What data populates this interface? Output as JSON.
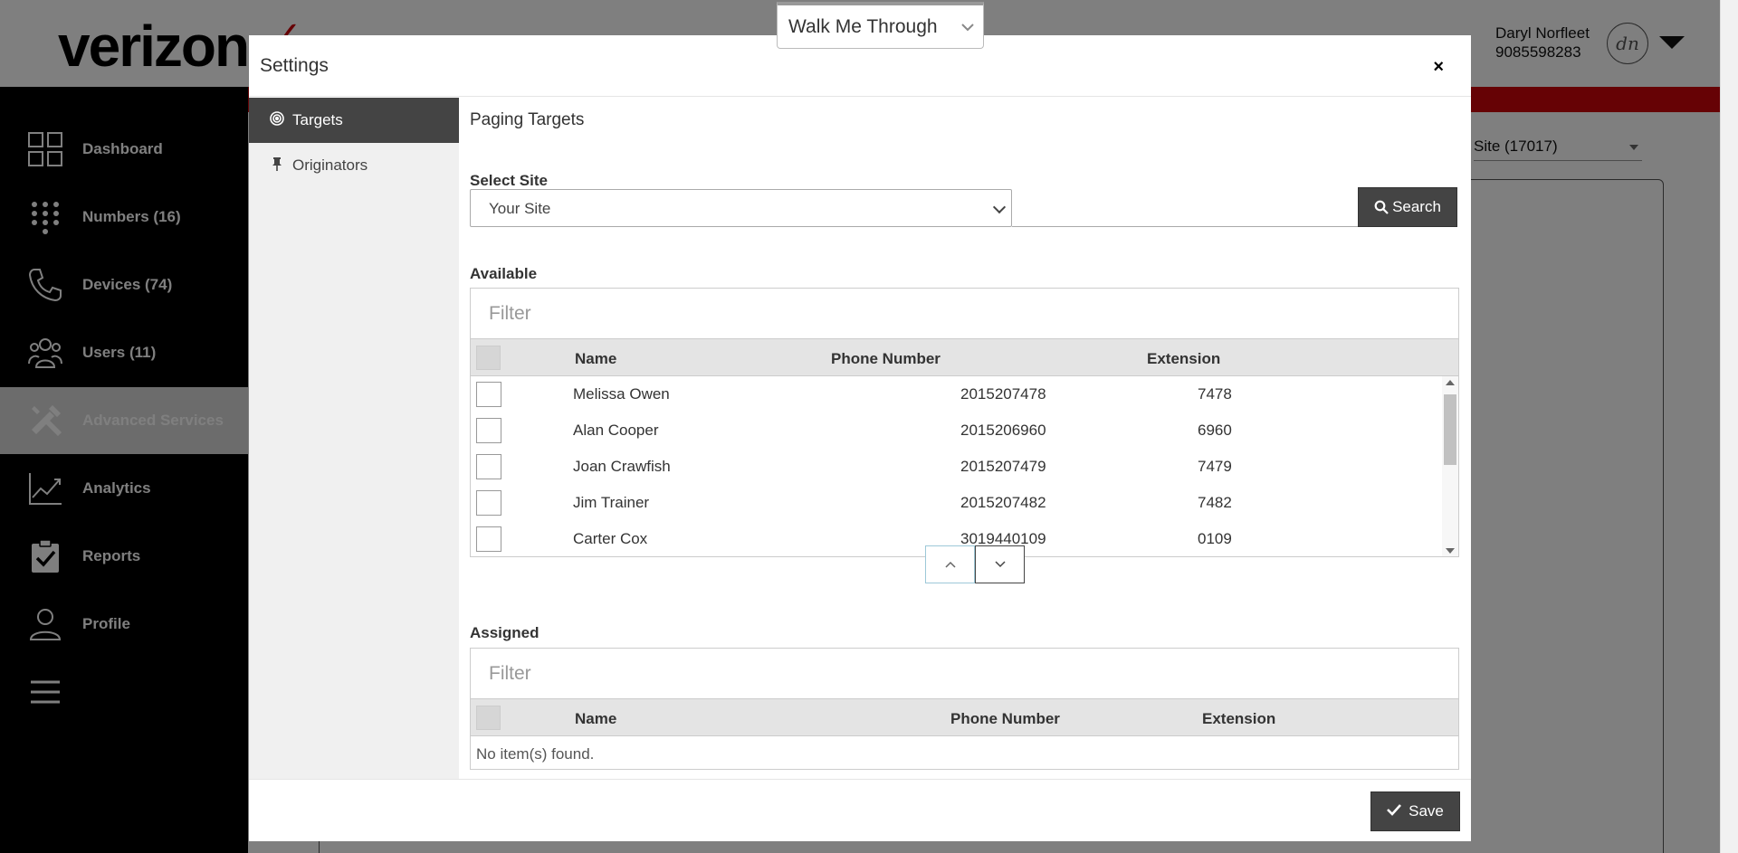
{
  "brand": {
    "logo_text": "verizon",
    "logo_mark": "✓"
  },
  "user": {
    "name": "Daryl Norfleet",
    "phone": "9085598283",
    "initials": "dn"
  },
  "background": {
    "site_select_value": "Site (17017)"
  },
  "sidebar": {
    "items": [
      {
        "label": "Dashboard",
        "icon": "dashboard-icon"
      },
      {
        "label": "Numbers (16)",
        "icon": "dialpad-icon"
      },
      {
        "label": "Devices (74)",
        "icon": "phone-icon"
      },
      {
        "label": "Users (11)",
        "icon": "users-icon"
      },
      {
        "label": "Advanced Services",
        "icon": "tools-icon",
        "active": true
      },
      {
        "label": "Analytics",
        "icon": "analytics-icon"
      },
      {
        "label": "Reports",
        "icon": "reports-icon"
      },
      {
        "label": "Profile",
        "icon": "profile-icon"
      },
      {
        "label": "",
        "icon": "menu-icon"
      }
    ]
  },
  "walkme": {
    "label": "Walk Me Through"
  },
  "modal": {
    "title": "Settings",
    "close": "×",
    "tabs": [
      {
        "label": "Targets",
        "icon": "target-icon",
        "active": true
      },
      {
        "label": "Originators",
        "icon": "pin-icon"
      }
    ],
    "section_title": "Paging Targets",
    "select_site_label": "Select Site",
    "site_value": "Your Site",
    "search_label": "Search",
    "available": {
      "label": "Available",
      "filter_placeholder": "Filter",
      "columns": [
        "Name",
        "Phone Number",
        "Extension"
      ],
      "rows": [
        {
          "name": "Melissa Owen",
          "phone": "2015207478",
          "ext": "7478"
        },
        {
          "name": "Alan Cooper",
          "phone": "2015206960",
          "ext": "6960"
        },
        {
          "name": "Joan Crawfish",
          "phone": "2015207479",
          "ext": "7479"
        },
        {
          "name": "Jim Trainer",
          "phone": "2015207482",
          "ext": "7482"
        },
        {
          "name": "Carter Cox",
          "phone": "3019440109",
          "ext": "0109"
        }
      ]
    },
    "assigned": {
      "label": "Assigned",
      "filter_placeholder": "Filter",
      "columns": [
        "Name",
        "Phone Number",
        "Extension"
      ],
      "empty_text": "No item(s) found."
    },
    "save_label": "Save"
  }
}
